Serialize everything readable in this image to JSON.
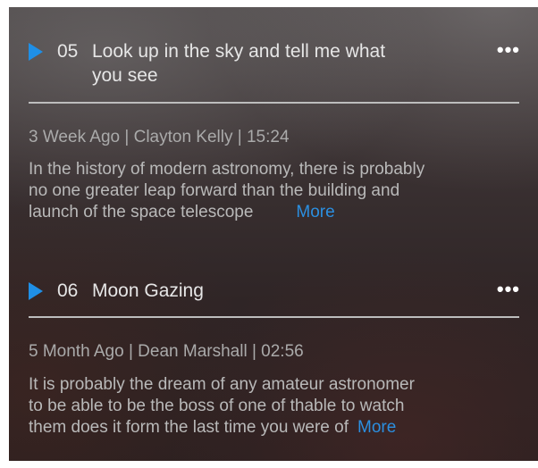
{
  "episodes": [
    {
      "number": "05",
      "title_lines": [
        "Look up in the sky and tell me what",
        "you see"
      ],
      "meta": "3 Week Ago | Clayton Kelly | 15:24",
      "desc_lines": [
        "In the history of modern astronomy, there is probably",
        "no one greater leap forward than the building and",
        "launch of the space telescope"
      ],
      "more_label": "More",
      "menu_glyph": "•••"
    },
    {
      "number": "06",
      "title_lines": [
        "Moon Gazing"
      ],
      "meta": "5 Month Ago | Dean Marshall | 02:56",
      "desc_lines": [
        "It is probably the dream of any amateur astronomer",
        "to be able to be the boss of one of thable to watch",
        "them does it form the last time you were of"
      ],
      "more_label": "More",
      "menu_glyph": "•••"
    }
  ],
  "colors": {
    "accent": "#1f8fe6",
    "link": "#2b8fe0",
    "title_text": "#e6e6e6",
    "meta_text": "#aaaaaa",
    "divider": "#bdbdbd"
  },
  "icons": {
    "play": "play-icon",
    "menu": "more-options-icon"
  }
}
